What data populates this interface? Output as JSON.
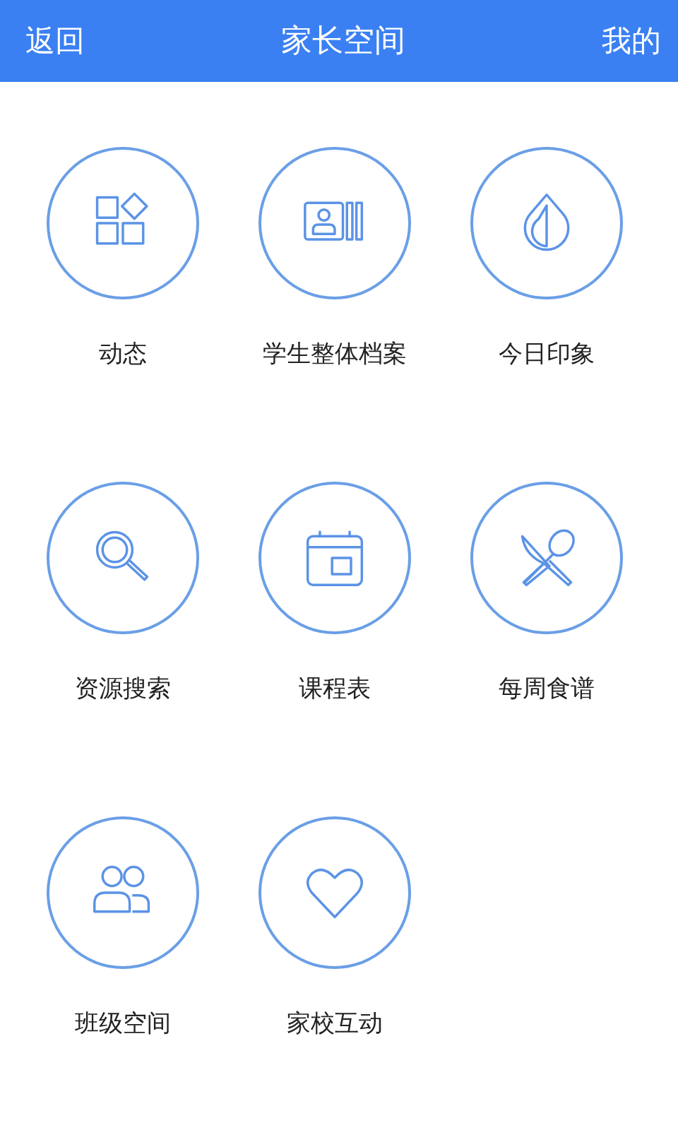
{
  "header": {
    "back": "返回",
    "title": "家长空间",
    "mine": "我的"
  },
  "items": [
    {
      "label": "动态"
    },
    {
      "label": "学生整体档案"
    },
    {
      "label": "今日印象"
    },
    {
      "label": "资源搜索"
    },
    {
      "label": "课程表"
    },
    {
      "label": "每周食谱"
    },
    {
      "label": "班级空间"
    },
    {
      "label": "家校互动"
    }
  ]
}
